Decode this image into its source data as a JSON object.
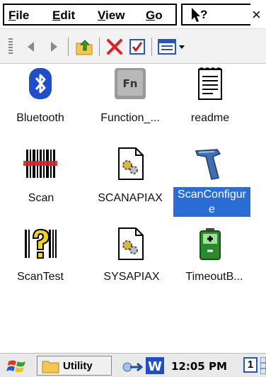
{
  "menubar": {
    "items": [
      {
        "label": "File",
        "accel": "F",
        "rest": "ile"
      },
      {
        "label": "Edit",
        "accel": "E",
        "rest": "dit"
      },
      {
        "label": "View",
        "accel": "V",
        "rest": "iew"
      },
      {
        "label": "Go",
        "accel": "G",
        "rest": "o"
      }
    ],
    "help_label": "?",
    "close_label": "×"
  },
  "icons": [
    {
      "label": "Bluetooth",
      "icon": "bluetooth-icon",
      "selected": false
    },
    {
      "label": "Function_...",
      "icon": "fn-key-icon",
      "selected": false
    },
    {
      "label": "readme",
      "icon": "text-document-icon",
      "selected": false
    },
    {
      "label": "Scan",
      "icon": "barcode-scan-icon",
      "selected": false
    },
    {
      "label": "SCANAPIAX",
      "icon": "system-file-icon",
      "selected": false
    },
    {
      "label": "ScanConfigure",
      "label_line1": "ScanConfigur",
      "label_line2": "e",
      "icon": "scanner-gun-icon",
      "selected": true
    },
    {
      "label": "ScanTest",
      "icon": "barcode-help-icon",
      "selected": false
    },
    {
      "label": "SYSAPIAX",
      "icon": "system-file-icon",
      "selected": false
    },
    {
      "label": "TimeoutB...",
      "icon": "battery-icon",
      "selected": false
    }
  ],
  "taskbar": {
    "task_label": "Utility",
    "time": "12:05 PM",
    "page_number": "1"
  },
  "colors": {
    "selection": "#2a6dd5",
    "accent_blue": "#2a56b0"
  }
}
